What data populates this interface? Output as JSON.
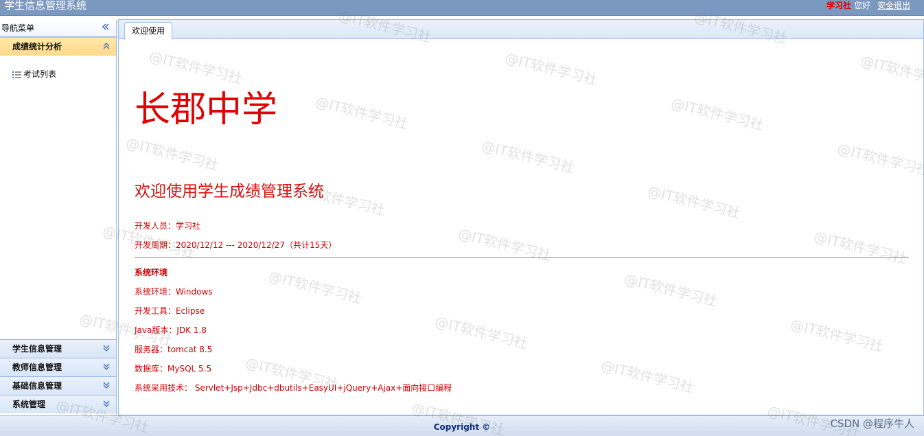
{
  "header": {
    "app_title": "学生信息管理系统",
    "user_name": "学习社",
    "greeting": "您好",
    "logout_label": "安全退出"
  },
  "sidebar": {
    "title": "导航菜单",
    "active_section": {
      "label": "成绩统计分析",
      "items": [
        {
          "label": "考试列表",
          "icon": "list-icon"
        }
      ]
    },
    "sections": [
      {
        "label": "学生信息管理"
      },
      {
        "label": "教师信息管理"
      },
      {
        "label": "基础信息管理"
      },
      {
        "label": "系统管理"
      }
    ]
  },
  "tabs": [
    {
      "label": "欢迎使用",
      "active": true
    }
  ],
  "welcome_page": {
    "school_name": "长郡中学",
    "welcome_text": "欢迎使用学生成绩管理系统",
    "developer": "开发人员：学习社",
    "dev_period": "开发周期：2020/12/12 --- 2020/12/27（共计15天）",
    "env_heading": "系统环境",
    "env_lines": [
      "系统环境：Windows",
      "开发工具：Eclipse",
      "Java版本：JDK 1.8",
      "服务器：tomcat 8.5",
      "数据库：MySQL 5.5",
      "系统采用技术： Servlet+Jsp+Jdbc+dbutils+EasyUI+jQuery+Ajax+面向接口编程"
    ]
  },
  "footer": {
    "copyright": "Copyright ©",
    "credit": "CSDN @程序牛人"
  },
  "watermark_text": "@IT软件学习社",
  "colors": {
    "header_bg": "#7b98c1",
    "accent_red": "#e30000",
    "active_section_bg": "#ffd98a",
    "border_blue": "#99bbe8",
    "copyright_blue": "#0c2a78"
  }
}
